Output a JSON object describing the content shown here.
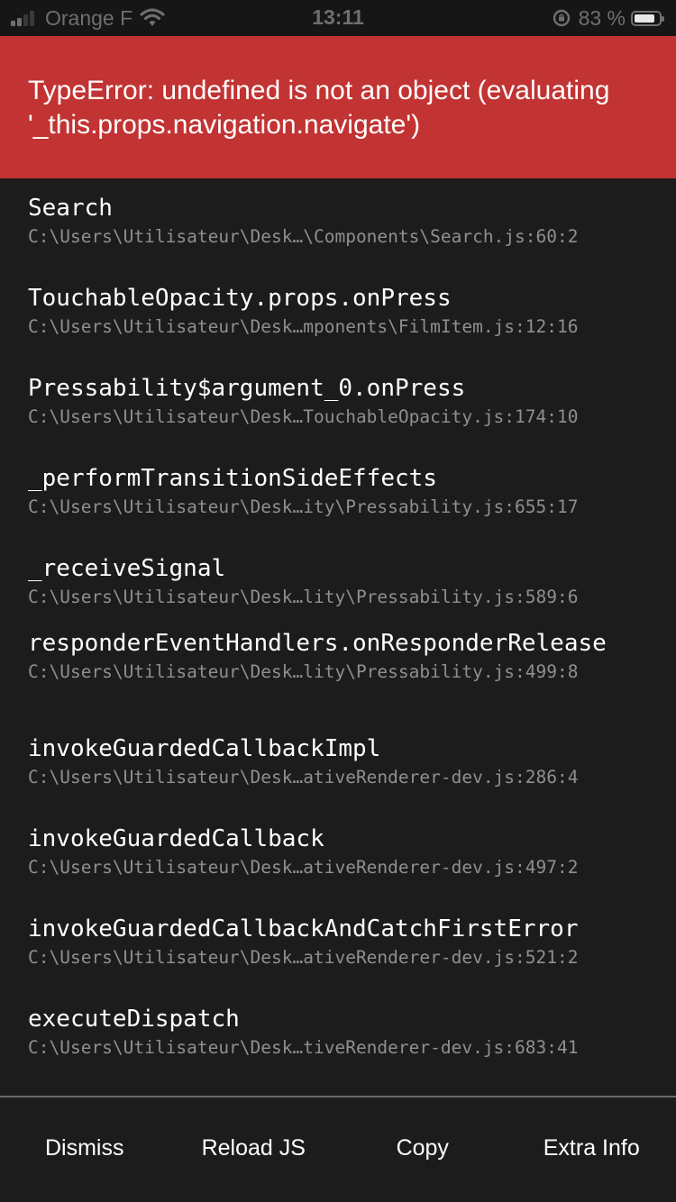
{
  "status_bar": {
    "carrier": "Orange F",
    "time": "13:11",
    "battery_percent": "83 %",
    "battery_level": 0.83,
    "icons": [
      "signal-bars-icon",
      "wifi-icon",
      "orientation-lock-icon",
      "battery-icon"
    ]
  },
  "error": {
    "message": "TypeError: undefined is not an object (evaluating '_this.props.navigation.navigate')",
    "background_color": "#c23333"
  },
  "stack": [
    {
      "method": "Search",
      "file": "C:\\Users\\Utilisateur\\Desk…\\Components\\Search.js:60:2"
    },
    {
      "method": "TouchableOpacity.props.onPress",
      "file": "C:\\Users\\Utilisateur\\Desk…mponents\\FilmItem.js:12:16"
    },
    {
      "method": "Pressability$argument_0.onPress",
      "file": "C:\\Users\\Utilisateur\\Desk…TouchableOpacity.js:174:10"
    },
    {
      "method": "_performTransitionSideEffects",
      "file": "C:\\Users\\Utilisateur\\Desk…ity\\Pressability.js:655:17"
    },
    {
      "method": "_receiveSignal",
      "file": "C:\\Users\\Utilisateur\\Desk…lity\\Pressability.js:589:6"
    },
    {
      "method": "responderEventHandlers.onResponderRelease",
      "file": "C:\\Users\\Utilisateur\\Desk…lity\\Pressability.js:499:8"
    },
    {
      "method": "invokeGuardedCallbackImpl",
      "file": "C:\\Users\\Utilisateur\\Desk…ativeRenderer-dev.js:286:4"
    },
    {
      "method": "invokeGuardedCallback",
      "file": "C:\\Users\\Utilisateur\\Desk…ativeRenderer-dev.js:497:2"
    },
    {
      "method": "invokeGuardedCallbackAndCatchFirstError",
      "file": "C:\\Users\\Utilisateur\\Desk…ativeRenderer-dev.js:521:2"
    },
    {
      "method": "executeDispatch",
      "file": "C:\\Users\\Utilisateur\\Desk…tiveRenderer-dev.js:683:41"
    }
  ],
  "toolbar": {
    "dismiss": "Dismiss",
    "reload": "Reload JS",
    "copy": "Copy",
    "extra_info": "Extra Info"
  }
}
